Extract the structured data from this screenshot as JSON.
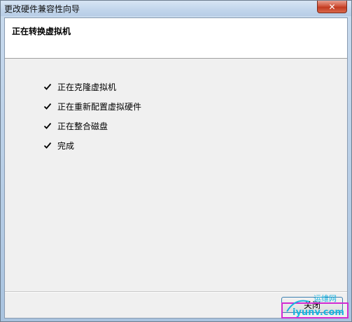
{
  "window": {
    "title": "更改硬件兼容性向导"
  },
  "header": {
    "title": "正在转换虚拟机"
  },
  "steps": [
    {
      "label": "正在克隆虚拟机"
    },
    {
      "label": "正在重新配置虚拟硬件"
    },
    {
      "label": "正在整合磁盘"
    },
    {
      "label": "完成"
    }
  ],
  "footer": {
    "close_label": "关闭"
  },
  "watermark": {
    "line1": "运维网",
    "line2": "iyunv.com"
  },
  "colors": {
    "watermark_cyan": "#19b4e0",
    "watermark_magenta": "#d22ad2",
    "close_accent": "#3c7fb1"
  }
}
